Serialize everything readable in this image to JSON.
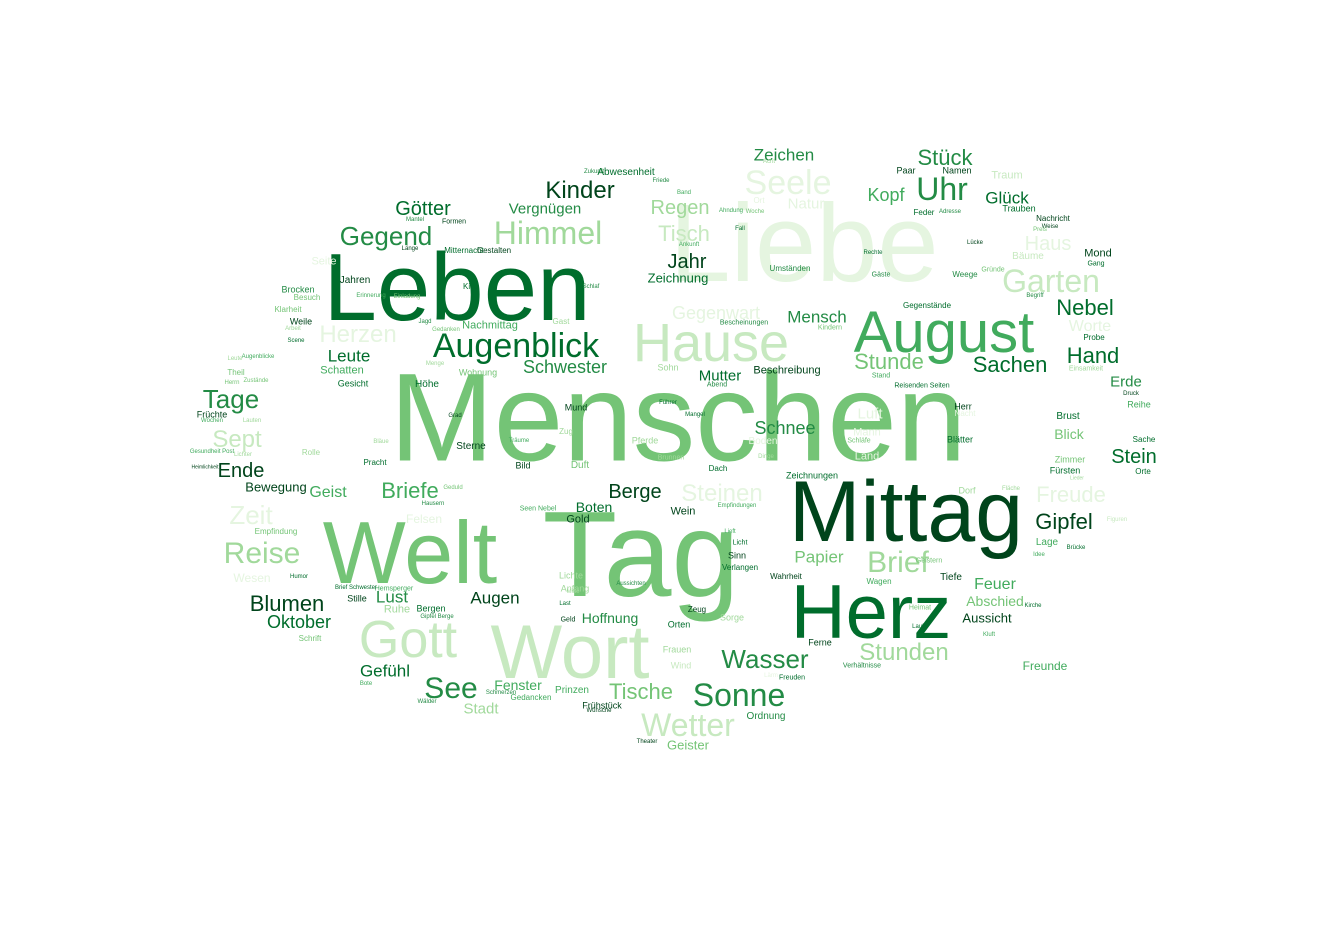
{
  "colors": {
    "c1": "#00441b",
    "c2": "#006d2c",
    "c3": "#238b45",
    "c4": "#41ab5d",
    "c5": "#74c476",
    "c6": "#a1d99b",
    "c7": "#c7e9c0",
    "c8": "#e5f5e0"
  },
  "words": [
    {
      "text": "Menschen",
      "c": "c5"
    },
    {
      "text": "Tag",
      "c": "c5"
    },
    {
      "text": "Liebe",
      "c": "c8"
    },
    {
      "text": "Leben",
      "c": "c2"
    },
    {
      "text": "Mittag",
      "c": "c1"
    },
    {
      "text": "Welt",
      "c": "c5"
    },
    {
      "text": "Herz",
      "c": "c2"
    },
    {
      "text": "Wort",
      "c": "c7"
    },
    {
      "text": "August",
      "c": "c4"
    },
    {
      "text": "Hause",
      "c": "c7"
    },
    {
      "text": "Gott",
      "c": "c7"
    },
    {
      "text": "Augenblick",
      "c": "c2"
    },
    {
      "text": "Himmel",
      "c": "c6"
    },
    {
      "text": "Seele",
      "c": "c8"
    },
    {
      "text": "Uhr",
      "c": "c3"
    },
    {
      "text": "Garten",
      "c": "c7"
    },
    {
      "text": "Reise",
      "c": "c6"
    },
    {
      "text": "Sonne",
      "c": "c3"
    },
    {
      "text": "Wetter",
      "c": "c7"
    },
    {
      "text": "Brief",
      "c": "c6"
    },
    {
      "text": "See",
      "c": "c3"
    },
    {
      "text": "Gegend",
      "c": "c3"
    },
    {
      "text": "Kinder",
      "c": "c1"
    },
    {
      "text": "Wasser",
      "c": "c3"
    },
    {
      "text": "Tage",
      "c": "c3"
    },
    {
      "text": "Zeit",
      "c": "c8"
    },
    {
      "text": "Blumen",
      "c": "c1"
    },
    {
      "text": "Herzen",
      "c": "c8"
    },
    {
      "text": "Steinen",
      "c": "c8"
    },
    {
      "text": "Freude",
      "c": "c8"
    },
    {
      "text": "Stunden",
      "c": "c6"
    },
    {
      "text": "Sept",
      "c": "c7"
    },
    {
      "text": "Stück",
      "c": "c3"
    },
    {
      "text": "Götter",
      "c": "c2"
    },
    {
      "text": "Tisch",
      "c": "c7"
    },
    {
      "text": "Regen",
      "c": "c6"
    },
    {
      "text": "Jahr",
      "c": "c1"
    },
    {
      "text": "Haus",
      "c": "c8"
    },
    {
      "text": "Nebel",
      "c": "c2"
    },
    {
      "text": "Hand",
      "c": "c2"
    },
    {
      "text": "Sachen",
      "c": "c2"
    },
    {
      "text": "Stunde",
      "c": "c5"
    },
    {
      "text": "Gipfel",
      "c": "c1"
    },
    {
      "text": "Stein",
      "c": "c2"
    },
    {
      "text": "Briefe",
      "c": "c4"
    },
    {
      "text": "Berge",
      "c": "c1"
    },
    {
      "text": "Ende",
      "c": "c1"
    },
    {
      "text": "Tische",
      "c": "c5"
    },
    {
      "text": "Schnee",
      "c": "c3"
    },
    {
      "text": "Oktober",
      "c": "c2"
    },
    {
      "text": "Zeichen",
      "c": "c3"
    },
    {
      "text": "Kopf",
      "c": "c4"
    },
    {
      "text": "Glück",
      "c": "c2"
    },
    {
      "text": "Gegenwart",
      "c": "c8"
    },
    {
      "text": "Mensch",
      "c": "c3"
    },
    {
      "text": "Schwester",
      "c": "c3"
    },
    {
      "text": "Leute",
      "c": "c2"
    },
    {
      "text": "Vergnügen",
      "c": "c3"
    },
    {
      "text": "Lust",
      "c": "c3"
    },
    {
      "text": "Augen",
      "c": "c1"
    },
    {
      "text": "Papier",
      "c": "c5"
    },
    {
      "text": "Feuer",
      "c": "c4"
    },
    {
      "text": "Gefühl",
      "c": "c2"
    },
    {
      "text": "Geist",
      "c": "c4"
    },
    {
      "text": "Natur",
      "c": "c8"
    },
    {
      "text": "Worte",
      "c": "c8"
    },
    {
      "text": "Erde",
      "c": "c3"
    },
    {
      "text": "Luft",
      "c": "c8"
    },
    {
      "text": "Blick",
      "c": "c5"
    },
    {
      "text": "Geister",
      "c": "c5"
    },
    {
      "text": "Boten",
      "c": "c2"
    },
    {
      "text": "Fenster",
      "c": "c4"
    },
    {
      "text": "Mutter",
      "c": "c2"
    },
    {
      "text": "Hoffnung",
      "c": "c3"
    },
    {
      "text": "Stadt",
      "c": "c6"
    },
    {
      "text": "Abschied",
      "c": "c5"
    },
    {
      "text": "Aussicht",
      "c": "c1"
    },
    {
      "text": "Freunde",
      "c": "c4"
    },
    {
      "text": "Zeichnung",
      "c": "c2"
    },
    {
      "text": "Felsen",
      "c": "c8"
    },
    {
      "text": "Nachmittag",
      "c": "c4"
    },
    {
      "text": "Schatten",
      "c": "c4"
    },
    {
      "text": "Wesen",
      "c": "c8"
    },
    {
      "text": "Bewegung",
      "c": "c1"
    },
    {
      "text": "Beschreibung",
      "c": "c1"
    },
    {
      "text": "Ruhe",
      "c": "c6"
    },
    {
      "text": "Seite",
      "c": "c8"
    },
    {
      "text": "Land",
      "c": "c8"
    },
    {
      "text": "Mond",
      "c": "c1"
    },
    {
      "text": "Bäume",
      "c": "c7"
    },
    {
      "text": "Traum",
      "c": "c7"
    },
    {
      "text": "Mann",
      "c": "c8"
    },
    {
      "text": "Boden",
      "c": "c8"
    },
    {
      "text": "Gold",
      "c": "c1"
    },
    {
      "text": "Mund",
      "c": "c1"
    },
    {
      "text": "Duft",
      "c": "c5"
    },
    {
      "text": "Jahren",
      "c": "c1"
    },
    {
      "text": "Weile",
      "c": "c1"
    },
    {
      "text": "Brocken",
      "c": "c3"
    },
    {
      "text": "Gesicht",
      "c": "c2"
    },
    {
      "text": "Höhe",
      "c": "c2"
    },
    {
      "text": "Reihe",
      "c": "c4"
    },
    {
      "text": "Sache",
      "c": "c2"
    },
    {
      "text": "Sterne",
      "c": "c1"
    },
    {
      "text": "Wein",
      "c": "c1"
    },
    {
      "text": "Wind",
      "c": "c7"
    },
    {
      "text": "Ordnung",
      "c": "c3"
    },
    {
      "text": "Prinzen",
      "c": "c4"
    },
    {
      "text": "Frühstück",
      "c": "c1"
    },
    {
      "text": "Gedancken",
      "c": "c4"
    },
    {
      "text": "Bergen",
      "c": "c2"
    },
    {
      "text": "Stille",
      "c": "c1"
    },
    {
      "text": "Tiefe",
      "c": "c1"
    },
    {
      "text": "Lage",
      "c": "c4"
    },
    {
      "text": "Zimmer",
      "c": "c5"
    },
    {
      "text": "Fürsten",
      "c": "c2"
    },
    {
      "text": "Brust",
      "c": "c2"
    },
    {
      "text": "Blätter",
      "c": "c2"
    },
    {
      "text": "Dorf",
      "c": "c6"
    },
    {
      "text": "Mitternacht",
      "c": "c2"
    },
    {
      "text": "Gestalten",
      "c": "c1"
    },
    {
      "text": "Orten",
      "c": "c2"
    },
    {
      "text": "Sorge",
      "c": "c6"
    },
    {
      "text": "Frauen",
      "c": "c6"
    },
    {
      "text": "Nacht",
      "c": "c8"
    },
    {
      "text": "Herr",
      "c": "c1"
    },
    {
      "text": "Theil",
      "c": "c5"
    },
    {
      "text": "Früchte",
      "c": "c1"
    },
    {
      "text": "Klarheit",
      "c": "c5"
    },
    {
      "text": "Besuch",
      "c": "c5"
    },
    {
      "text": "Kind",
      "c": "c2"
    },
    {
      "text": "Gast",
      "c": "c6"
    },
    {
      "text": "Sohn",
      "c": "c6"
    },
    {
      "text": "Wohnung",
      "c": "c5"
    },
    {
      "text": "Rolle",
      "c": "c6"
    },
    {
      "text": "Pracht",
      "c": "c2"
    },
    {
      "text": "Humor",
      "c": "c2"
    },
    {
      "text": "Geld",
      "c": "c1"
    },
    {
      "text": "Bild",
      "c": "c1"
    },
    {
      "text": "Zug",
      "c": "c6"
    },
    {
      "text": "Lichte",
      "c": "c6"
    },
    {
      "text": "Anfang",
      "c": "c6"
    },
    {
      "text": "Pferde",
      "c": "c6"
    },
    {
      "text": "Brunnen",
      "c": "c6"
    },
    {
      "text": "Dach",
      "c": "c2"
    },
    {
      "text": "Licht",
      "c": "c2"
    },
    {
      "text": "Sinn",
      "c": "c1"
    },
    {
      "text": "Verlangen",
      "c": "c2"
    },
    {
      "text": "Zeug",
      "c": "c1"
    },
    {
      "text": "Ferne",
      "c": "c1"
    },
    {
      "text": "Wahrheit",
      "c": "c1"
    },
    {
      "text": "Wagen",
      "c": "c4"
    },
    {
      "text": "Zeichnungen",
      "c": "c2"
    },
    {
      "text": "Orte",
      "c": "c2"
    },
    {
      "text": "Schrift",
      "c": "c5"
    },
    {
      "text": "Empfindung",
      "c": "c5"
    },
    {
      "text": "Abwesenheit",
      "c": "c2"
    },
    {
      "text": "Ort",
      "c": "c8"
    },
    {
      "text": "Namen",
      "c": "c1"
    },
    {
      "text": "Paar",
      "c": "c1"
    },
    {
      "text": "Feder",
      "c": "c2"
    },
    {
      "text": "Trauben",
      "c": "c2"
    },
    {
      "text": "Nachricht",
      "c": "c1"
    },
    {
      "text": "Umständen",
      "c": "c3"
    },
    {
      "text": "Weege",
      "c": "c3"
    },
    {
      "text": "Gründe",
      "c": "c5"
    },
    {
      "text": "Gäste",
      "c": "c3"
    },
    {
      "text": "Rechte",
      "c": "c2"
    },
    {
      "text": "Begriff",
      "c": "c3"
    },
    {
      "text": "Gegenstände",
      "c": "c2"
    },
    {
      "text": "Einsamkeit",
      "c": "c6"
    },
    {
      "text": "Probe",
      "c": "c2"
    },
    {
      "text": "Gang",
      "c": "c2"
    },
    {
      "text": "Druck",
      "c": "c1"
    },
    {
      "text": "Stand",
      "c": "c4"
    },
    {
      "text": "Reisenden Seiten",
      "c": "c2"
    },
    {
      "text": "Abend",
      "c": "c3"
    },
    {
      "text": "Führer",
      "c": "c2"
    },
    {
      "text": "Mangel",
      "c": "c2"
    },
    {
      "text": "Grad",
      "c": "c1"
    },
    {
      "text": "Träume",
      "c": "c4"
    },
    {
      "text": "Geduld",
      "c": "c5"
    },
    {
      "text": "Hausern",
      "c": "c3"
    },
    {
      "text": "Empfindungen",
      "c": "c4"
    },
    {
      "text": "Schmerzen",
      "c": "c3"
    },
    {
      "text": "Wälder",
      "c": "c3"
    },
    {
      "text": "Wünsche",
      "c": "c1"
    },
    {
      "text": "Theater",
      "c": "c1"
    },
    {
      "text": "Last",
      "c": "c2"
    },
    {
      "text": "Gipfel Berge",
      "c": "c3"
    },
    {
      "text": "Aussichten",
      "c": "c3"
    },
    {
      "text": "Heimat",
      "c": "c5"
    },
    {
      "text": "Lauf",
      "c": "c2"
    },
    {
      "text": "Kluft",
      "c": "c4"
    },
    {
      "text": "Kirche",
      "c": "c2"
    },
    {
      "text": "Verhältnisse",
      "c": "c3"
    },
    {
      "text": "Freuden",
      "c": "c2"
    },
    {
      "text": "Geistern",
      "c": "c5"
    },
    {
      "text": "Figuren",
      "c": "c7"
    },
    {
      "text": "Brücke",
      "c": "c2"
    },
    {
      "text": "Idee",
      "c": "c4"
    },
    {
      "text": "Lieder",
      "c": "c6"
    },
    {
      "text": "Kindern",
      "c": "c5"
    },
    {
      "text": "Schläfe",
      "c": "c5"
    },
    {
      "text": "Dinge",
      "c": "c6"
    },
    {
      "text": "Fläche",
      "c": "c6"
    },
    {
      "text": "Lücke",
      "c": "c1"
    },
    {
      "text": "Friede",
      "c": "c3"
    },
    {
      "text": "Band",
      "c": "c4"
    },
    {
      "text": "Ahndung",
      "c": "c4"
    },
    {
      "text": "Woche",
      "c": "c5"
    },
    {
      "text": "Fall",
      "c": "c2"
    },
    {
      "text": "Ankunft",
      "c": "c4"
    },
    {
      "text": "Acht",
      "c": "c6"
    },
    {
      "text": "Adresse",
      "c": "c3"
    },
    {
      "text": "Weise",
      "c": "c1"
    },
    {
      "text": "Preis",
      "c": "c5"
    },
    {
      "text": "Formen",
      "c": "c1"
    },
    {
      "text": "Mantel",
      "c": "c3"
    },
    {
      "text": "Länge",
      "c": "c1"
    },
    {
      "text": "Einladung",
      "c": "c5"
    },
    {
      "text": "Erinnerung",
      "c": "c4"
    },
    {
      "text": "Jagd",
      "c": "c3"
    },
    {
      "text": "Gedanken",
      "c": "c5"
    },
    {
      "text": "Arbeit",
      "c": "c6"
    },
    {
      "text": "Scene",
      "c": "c2"
    },
    {
      "text": "Augenblicke",
      "c": "c4"
    },
    {
      "text": "Zustände",
      "c": "c5"
    },
    {
      "text": "Zukunft",
      "c": "c3"
    },
    {
      "text": "Lauten",
      "c": "c6"
    },
    {
      "text": "Gesundheit Post",
      "c": "c4"
    },
    {
      "text": "Wochen",
      "c": "c4"
    },
    {
      "text": "Bescheinungen",
      "c": "c3"
    },
    {
      "text": "Heimlichkeit",
      "c": "c1"
    },
    {
      "text": "Hemsperger",
      "c": "c4"
    },
    {
      "text": "Brief Schwester",
      "c": "c2"
    },
    {
      "text": "Bote",
      "c": "c4"
    },
    {
      "text": "Herrn",
      "c": "c5"
    },
    {
      "text": "Mitte",
      "c": "c6"
    },
    {
      "text": "Menge",
      "c": "c6"
    },
    {
      "text": "Leute",
      "c": "c6"
    },
    {
      "text": "Lichter",
      "c": "c6"
    },
    {
      "text": "Bläue",
      "c": "c6"
    },
    {
      "text": "Seen Nebel",
      "c": "c4"
    },
    {
      "text": "Schlaf",
      "c": "c3"
    },
    {
      "text": "Lärm",
      "c": "c8"
    },
    {
      "text": "Lieft",
      "c": "c4"
    },
    {
      "text": "Gegenstand",
      "c": "c4"
    },
    {
      "text": "Wunder",
      "c": "c6"
    },
    {
      "text": "Mitte Werke",
      "c": "c6"
    },
    {
      "text": "Dingen",
      "c": "c3"
    },
    {
      "text": "Hänge",
      "c": "c7"
    }
  ]
}
